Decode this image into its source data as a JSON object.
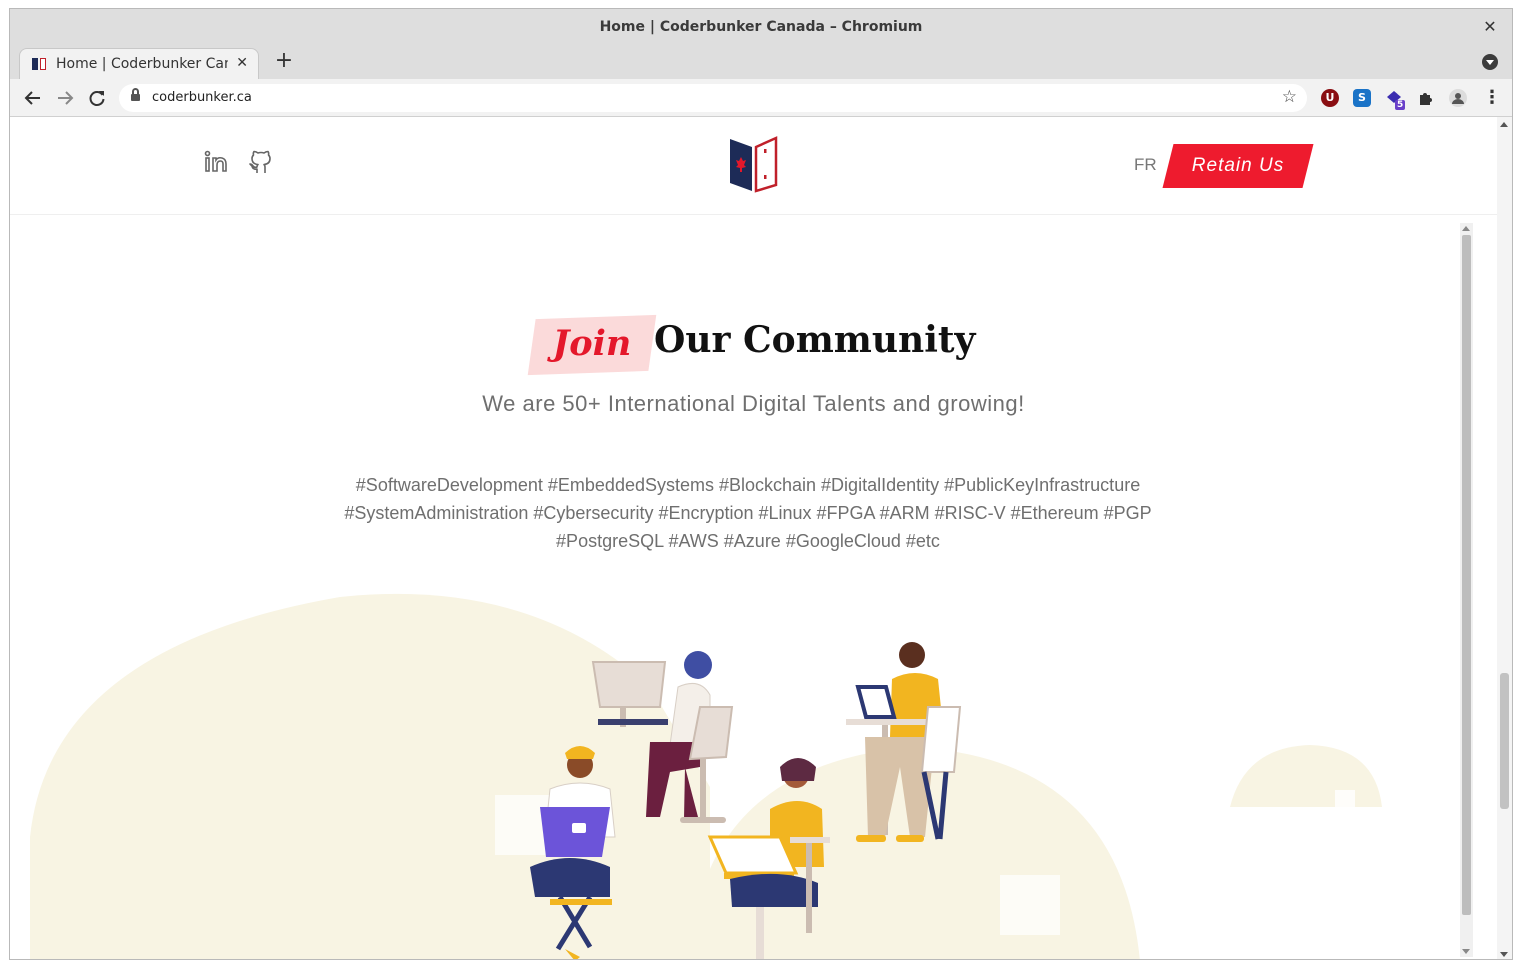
{
  "browser": {
    "window_title": "Home | Coderbunker Canada – Chromium",
    "tab_title": "Home | Coderbunker Canada",
    "url": "coderbunker.ca",
    "extension_badge": "5",
    "ext_u_label": "U",
    "ext_s_label": "S"
  },
  "header": {
    "lang_label": "FR",
    "retain_label": "Retain Us"
  },
  "community": {
    "highlight": "Join",
    "title_rest": "Our Community",
    "subtitle": "We are 50+ International Digital Talents and growing!",
    "tags_line1": "#SoftwareDevelopment #EmbeddedSystems #Blockchain #DigitalIdentity #PublicKeyInfrastructure",
    "tags_line2": "#SystemAdministration #Cybersecurity #Encryption #Linux #FPGA #ARM #RISC-V #Ethereum #PGP",
    "tags_line3": "#PostgreSQL #AWS #Azure #GoogleCloud #etc"
  },
  "colors": {
    "brand_red": "#ee1b2e",
    "brand_navy": "#1d2b57",
    "highlight_pink": "#fbdada",
    "blob_cream": "#f8f4e3"
  },
  "icons": [
    "linkedin-icon",
    "github-icon",
    "coderbunker-logo",
    "star-icon",
    "lock-icon",
    "extensions-icon",
    "profile-icon",
    "kebab-menu-icon"
  ]
}
